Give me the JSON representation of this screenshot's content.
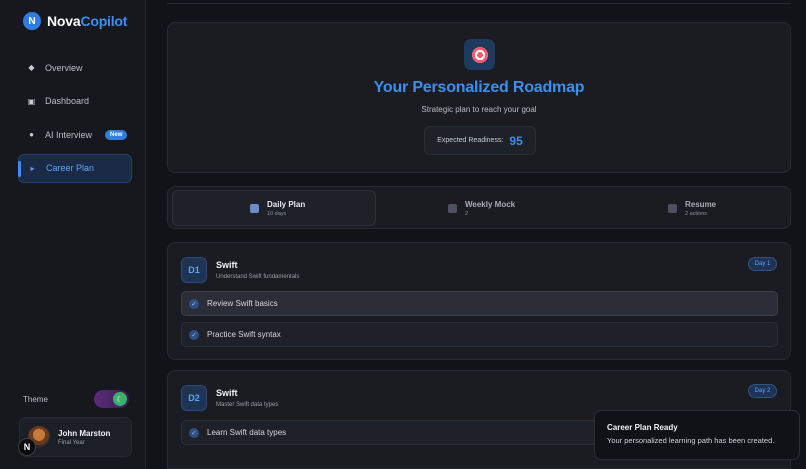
{
  "brand": {
    "logo_letter": "N",
    "name_primary": "Nova",
    "name_accent": "Copilot"
  },
  "sidebar": {
    "items": [
      {
        "label": "Overview",
        "icon": "diamond-icon"
      },
      {
        "label": "Dashboard",
        "icon": "square-icon"
      },
      {
        "label": "AI Interview",
        "icon": "dot-icon",
        "badge": "New"
      },
      {
        "label": "Career Plan",
        "icon": "triangle-icon",
        "active": true
      }
    ],
    "theme_label": "Theme",
    "user": {
      "name": "John Marston",
      "role": "Final Year"
    },
    "n_badge": "N"
  },
  "hero": {
    "icon": "target-icon",
    "title": "Your Personalized Roadmap",
    "subtitle": "Strategic plan to reach your goal",
    "readiness_label": "Expected Readiness:",
    "readiness_value": "95"
  },
  "tabs": [
    {
      "title": "Daily Plan",
      "sub": "10 days",
      "icon": "calendar-icon",
      "active": true
    },
    {
      "title": "Weekly Mock",
      "sub": "2",
      "icon": "calendar-icon"
    },
    {
      "title": "Resume",
      "sub": "2 actions",
      "icon": "document-icon"
    }
  ],
  "days": [
    {
      "code": "D1",
      "title": "Swift",
      "subtitle": "Understand Swift fundamentals",
      "pill": "Day 1",
      "tasks": [
        "Review Swift basics",
        "Practice Swift syntax"
      ]
    },
    {
      "code": "D2",
      "title": "Swift",
      "subtitle": "Master Swift data types",
      "pill": "Day 2",
      "tasks": [
        "Learn Swift data types"
      ]
    }
  ],
  "toast": {
    "title": "Career Plan Ready",
    "message": "Your personalized learning path has been created."
  },
  "colors": {
    "accent": "#3b8ff0",
    "background": "#121318",
    "card": "#1a1c22"
  }
}
